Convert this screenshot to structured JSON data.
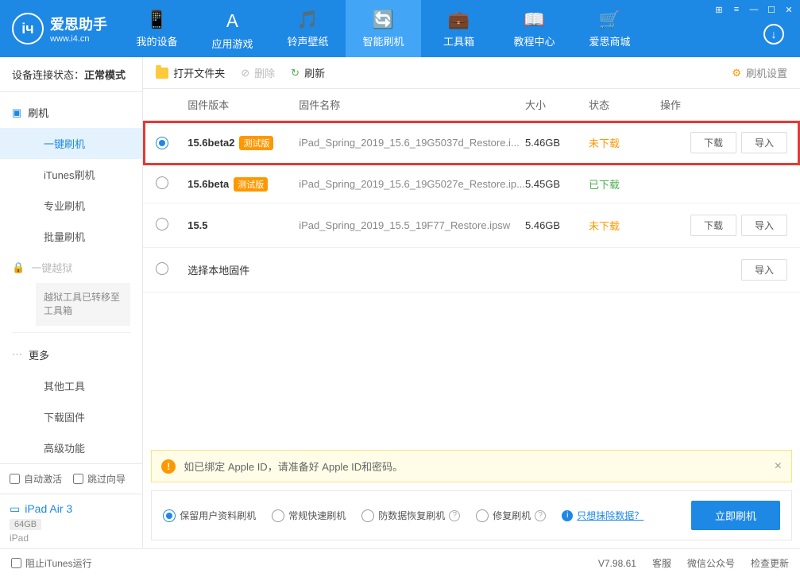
{
  "app": {
    "title": "爱思助手",
    "url": "www.i4.cn"
  },
  "nav": [
    {
      "label": "我的设备",
      "icon": "📱"
    },
    {
      "label": "应用游戏",
      "icon": "Ａ"
    },
    {
      "label": "铃声壁纸",
      "icon": "🎵"
    },
    {
      "label": "智能刷机",
      "icon": "🔄"
    },
    {
      "label": "工具箱",
      "icon": "💼"
    },
    {
      "label": "教程中心",
      "icon": "📖"
    },
    {
      "label": "爱思商城",
      "icon": "🛒"
    }
  ],
  "sidebar": {
    "status_label": "设备连接状态：",
    "status_value": "正常模式",
    "flash": {
      "head": "刷机",
      "items": [
        "一键刷机",
        "iTunes刷机",
        "专业刷机",
        "批量刷机"
      ]
    },
    "jailbreak": {
      "head": "一键越狱",
      "note": "越狱工具已转移至工具箱"
    },
    "more": {
      "head": "更多",
      "items": [
        "其他工具",
        "下载固件",
        "高级功能"
      ]
    },
    "auto_activate": "自动激活",
    "skip_guide": "跳过向导",
    "device": {
      "name": "iPad Air 3",
      "storage": "64GB",
      "type": "iPad"
    }
  },
  "toolbar": {
    "open_folder": "打开文件夹",
    "delete": "删除",
    "refresh": "刷新",
    "settings": "刷机设置"
  },
  "table": {
    "headers": {
      "version": "固件版本",
      "name": "固件名称",
      "size": "大小",
      "status": "状态",
      "actions": "操作"
    },
    "rows": [
      {
        "version": "15.6beta2",
        "badge": "测试版",
        "name": "iPad_Spring_2019_15.6_19G5037d_Restore.i...",
        "size": "5.46GB",
        "status": "未下载",
        "status_class": "nd",
        "selected": true,
        "highlighted": true,
        "show_actions": true
      },
      {
        "version": "15.6beta",
        "badge": "测试版",
        "name": "iPad_Spring_2019_15.6_19G5027e_Restore.ip...",
        "size": "5.45GB",
        "status": "已下载",
        "status_class": "dl",
        "selected": false,
        "show_actions": false
      },
      {
        "version": "15.5",
        "badge": "",
        "name": "iPad_Spring_2019_15.5_19F77_Restore.ipsw",
        "size": "5.46GB",
        "status": "未下载",
        "status_class": "nd",
        "selected": false,
        "show_actions": true
      }
    ],
    "local_firmware": "选择本地固件",
    "btn_download": "下载",
    "btn_import": "导入"
  },
  "warning": "如已绑定 Apple ID，请准备好 Apple ID和密码。",
  "options": {
    "keep_data": "保留用户资料刷机",
    "normal": "常规快速刷机",
    "anti_data": "防数据恢复刷机",
    "repair": "修复刷机",
    "erase_link": "只想抹除数据？",
    "start": "立即刷机"
  },
  "footer": {
    "block_itunes": "阻止iTunes运行",
    "version": "V7.98.61",
    "service": "客服",
    "wechat": "微信公众号",
    "update": "检查更新"
  }
}
